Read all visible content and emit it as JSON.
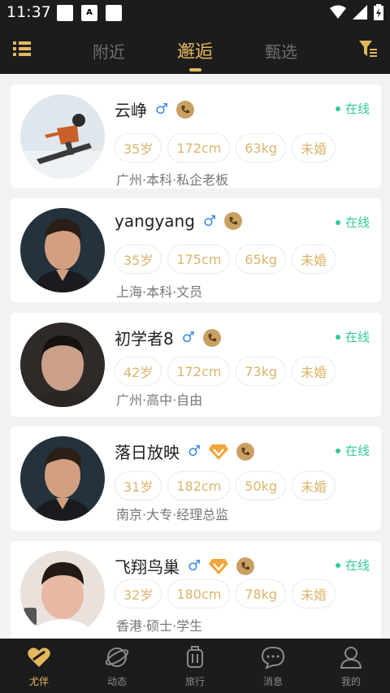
{
  "status_bar": {
    "time": "11:37"
  },
  "top_nav": {
    "tabs": [
      {
        "label": "附近",
        "active": false
      },
      {
        "label": "邂逅",
        "active": true
      },
      {
        "label": "甄选",
        "active": false
      }
    ]
  },
  "users": [
    {
      "name": "云峥",
      "gender": "♂",
      "vip": false,
      "online": "在线",
      "tags": [
        "35岁",
        "172cm",
        "63kg",
        "未婚"
      ],
      "meta": "广州·本科·私企老板",
      "avatar": "snowboarder"
    },
    {
      "name": "yangyang",
      "gender": "♂",
      "vip": false,
      "online": "在线",
      "tags": [
        "35岁",
        "175cm",
        "65kg",
        "未婚"
      ],
      "meta": "上海·本科·文员",
      "avatar": "man-dark-hair"
    },
    {
      "name": "初学者8",
      "gender": "♂",
      "vip": false,
      "online": "在线",
      "tags": [
        "42岁",
        "172cm",
        "73kg",
        "未婚"
      ],
      "meta": "广州·高中·自由",
      "avatar": "man-short-hair"
    },
    {
      "name": "落日放映",
      "gender": "♂",
      "vip": true,
      "online": "在线",
      "tags": [
        "31岁",
        "182cm",
        "50kg",
        "未婚"
      ],
      "meta": "南京·大专·经理总监",
      "avatar": "man-dark-hair"
    },
    {
      "name": "飞翔鸟巢",
      "gender": "♂",
      "vip": true,
      "online": "在线",
      "tags": [
        "32岁",
        "180cm",
        "78kg",
        "未婚"
      ],
      "meta": "香港·硕士·学生",
      "avatar": "young-man"
    }
  ],
  "bottom_nav": [
    {
      "label": "尤伴",
      "active": true,
      "icon": "heart-icon"
    },
    {
      "label": "动态",
      "active": false,
      "icon": "planet-icon"
    },
    {
      "label": "旅行",
      "active": false,
      "icon": "luggage-icon"
    },
    {
      "label": "消息",
      "active": false,
      "icon": "chat-icon"
    },
    {
      "label": "我的",
      "active": false,
      "icon": "profile-icon"
    }
  ],
  "colors": {
    "accent": "#e3b85c",
    "online": "#2ecc9a",
    "male": "#3a8be0",
    "dark_bar": "#1c1c1c"
  }
}
